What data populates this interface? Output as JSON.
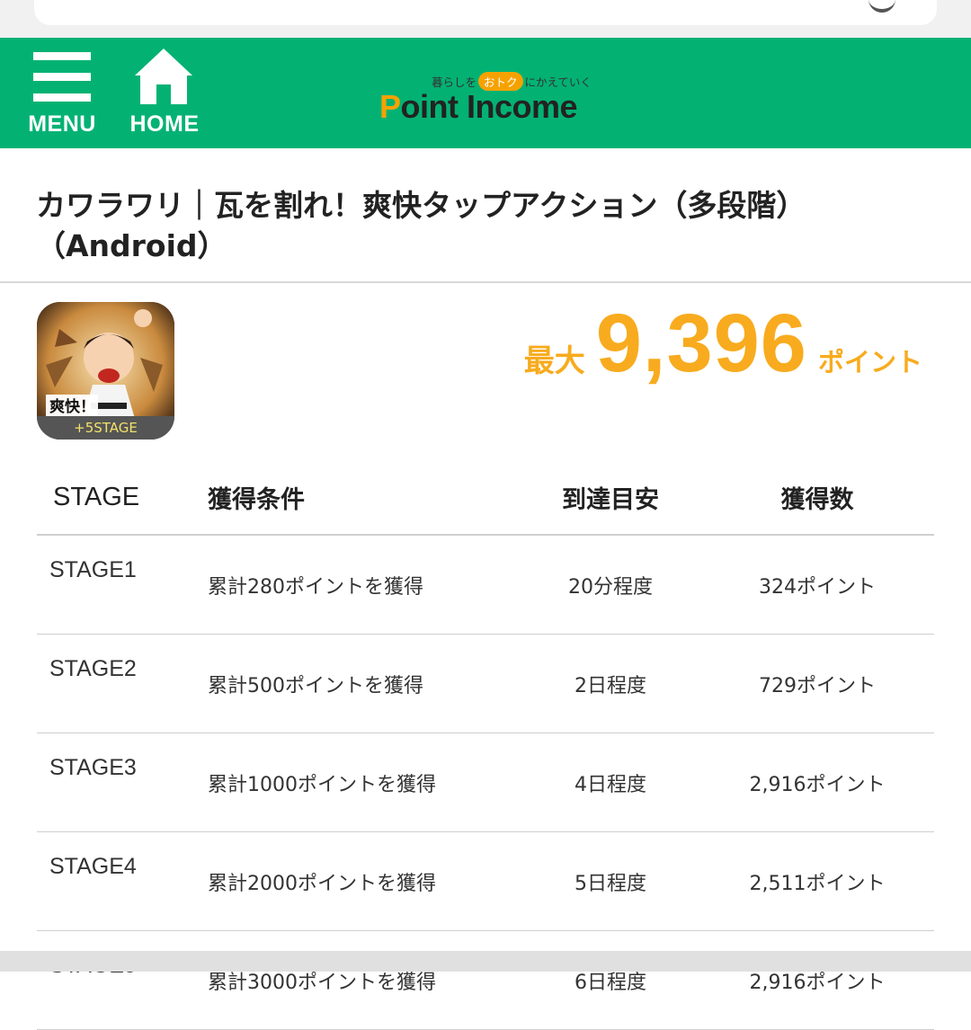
{
  "header": {
    "menu_label": "MENU",
    "home_label": "HOME",
    "logo_tag_before": "暮らしを",
    "logo_tag_highlight": "おトク",
    "logo_tag_after": "にかえていく",
    "logo_p": "P",
    "logo_rest": "oint Income",
    "brand_color": "#03b273"
  },
  "title": "カワラワリ｜瓦を割れ！爽快タップアクション（多段階）（Android）",
  "app": {
    "stage_badge": "+5STAGE",
    "icon_text": "爽快！"
  },
  "points": {
    "prefix": "最大",
    "value": "9,396",
    "suffix": "ポイント",
    "color": "#f8ab1e"
  },
  "table": {
    "headers": [
      "STAGE",
      "獲得条件",
      "到達目安",
      "獲得数"
    ],
    "rows": [
      {
        "stage": "STAGE1",
        "condition": "累計280ポイントを獲得",
        "estimate": "20分程度",
        "reward": "324ポイント"
      },
      {
        "stage": "STAGE2",
        "condition": "累計500ポイントを獲得",
        "estimate": "2日程度",
        "reward": "729ポイント"
      },
      {
        "stage": "STAGE3",
        "condition": "累計1000ポイントを獲得",
        "estimate": "4日程度",
        "reward": "2,916ポイント"
      },
      {
        "stage": "STAGE4",
        "condition": "累計2000ポイントを獲得",
        "estimate": "5日程度",
        "reward": "2,511ポイント"
      },
      {
        "stage": "STAGE5",
        "condition": "累計3000ポイントを獲得",
        "estimate": "6日程度",
        "reward": "2,916ポイント"
      }
    ]
  }
}
